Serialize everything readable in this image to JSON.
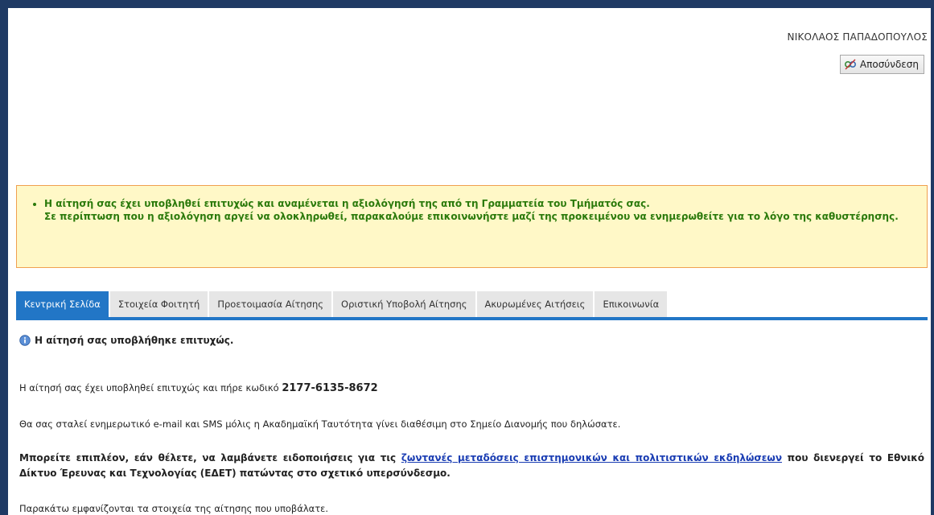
{
  "header": {
    "username": "ΝΙΚΟΛΑΟΣ ΠΑΠΑΔΟΠΟΥΛΟΣ",
    "logout_label": "Αποσύνδεση",
    "logout_icon": "logout-icon"
  },
  "notice": {
    "line1": "Η αίτησή σας έχει υποβληθεί επιτυχώς και αναμένεται η αξιολόγησή της από τη Γραμματεία του Τμήματός σας.",
    "line2": "Σε περίπτωση που η αξιολόγηση αργεί να ολοκληρωθεί, παρακαλούμε επικοινωνήστε μαζί της προκειμένου να ενημερωθείτε για το λόγο της καθυστέρησης.",
    "text_color": "#2b7a0b",
    "background": "#fff8c7",
    "border_color": "#f0a050"
  },
  "tabs": [
    {
      "label": "Κεντρική Σελίδα",
      "active": true
    },
    {
      "label": "Στοιχεία Φοιτητή",
      "active": false
    },
    {
      "label": "Προετοιμασία Αίτησης",
      "active": false
    },
    {
      "label": "Οριστική Υποβολή Αίτησης",
      "active": false
    },
    {
      "label": "Ακυρωμένες Αιτήσεις",
      "active": false
    },
    {
      "label": "Επικοινωνία",
      "active": false
    }
  ],
  "accent_color": "#2276c6",
  "content": {
    "success_title": "Η αίτησή σας υποβλήθηκε επιτυχώς.",
    "success_icon": "info-icon",
    "code_text": "Η αίτησή σας έχει υποβληθεί επιτυχώς και πήρε κωδικό",
    "code": "2177-6135-8672",
    "email_text": "Θα σας σταλεί ενημερωτικό e-mail και SMS μόλις η Ακαδημαϊκή Ταυτότητα γίνει διαθέσιμη στο Σημείο Διανομής που δηλώσατε.",
    "notify_before": "Μπορείτε επιπλέον, εάν θέλετε, να λαμβάνετε ειδοποιήσεις για τις",
    "notify_link": "ζωντανές μεταδόσεις επιστημονικών και πολιτιστικών εκδηλώσεων",
    "notify_after": "που διενεργεί το Εθνικό Δίκτυο Έρευνας και Τεχνολογίας (ΕΔΕΤ) πατώντας στο σχετικό υπερσύνδεσμο.",
    "details_text": "Παρακάτω εμφανίζονται τα στοιχεία της αίτησης που υποβάλατε."
  }
}
